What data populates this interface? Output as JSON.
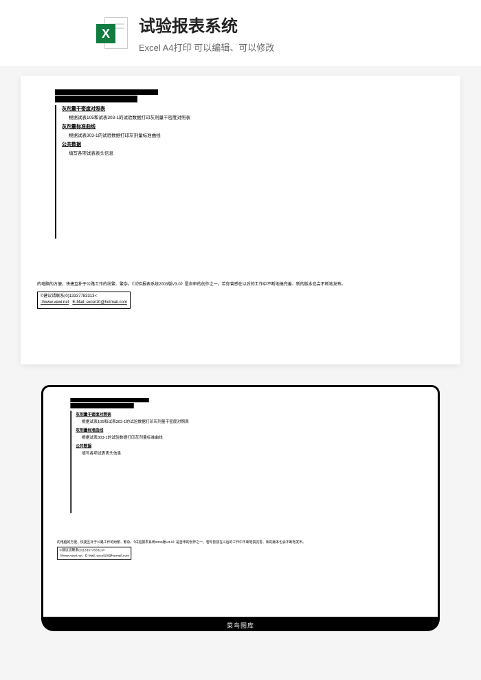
{
  "header": {
    "title": "试验报表系统",
    "subtitle": "Excel A4打印 可以编辑、可以修改",
    "icon_letter": "X"
  },
  "doc": {
    "links": {
      "link1": "灰剂量干密度对照表",
      "desc1": "根据试表105和试表303-1的试验数据打印灰剂量干密度对照表",
      "link2": "灰剂量标准曲线",
      "desc2": "根据试表303-1的试验数据打印灰剂量标准曲线",
      "link3": "公共数据",
      "desc3": "填写各项试表表头信息"
    },
    "footer_text": "的电脑的方便，快捷互补于公路工作的纷繁、繁杂。《试验报表系统2003版V3.0》是自申的创作之一。若你曾感在以后的工作中不断地搞完善、新的版本也会不断地发布。",
    "contact_line": "©建议请联系(0)13337783313<",
    "contact_url": "://www.vewi.net",
    "contact_email": "E-Mail: excel10@hotmail.com"
  },
  "laptop": {
    "base_text": "菜鸟图库"
  }
}
